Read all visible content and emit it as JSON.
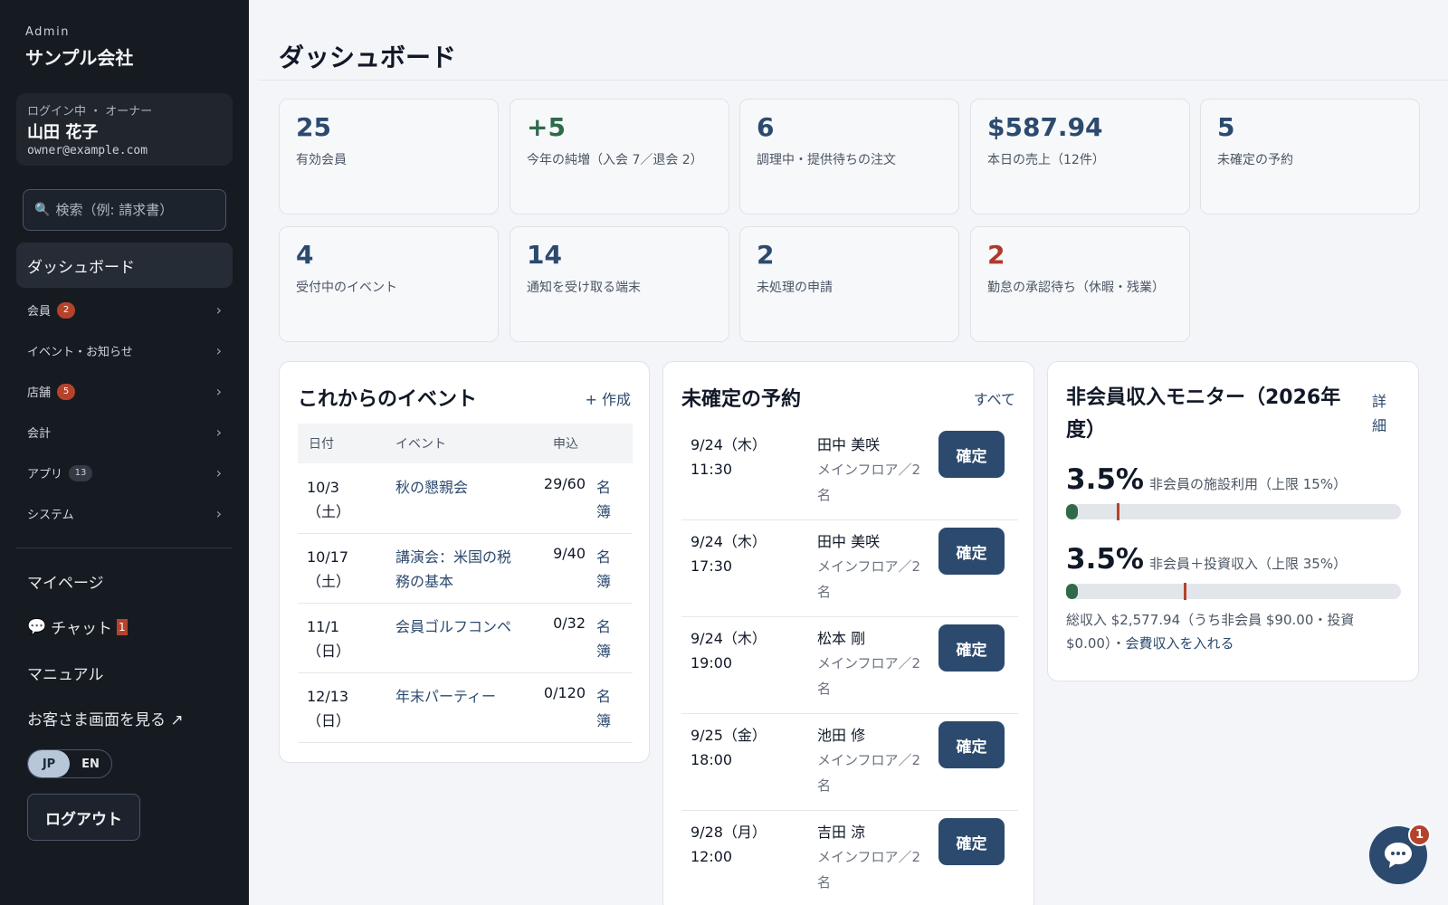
{
  "sidebar": {
    "brand_sub": "Admin",
    "brand_name": "サンプル会社",
    "user": {
      "role": "ログイン中 ・ オーナー",
      "name": "山田 花子",
      "email": "owner@example.com"
    },
    "search_placeholder": "検索（例: 請求書）",
    "active": "ダッシュボード",
    "items": [
      {
        "label": "会員",
        "badge": "2",
        "badge_type": "red"
      },
      {
        "label": "イベント・お知らせ",
        "badge": ""
      },
      {
        "label": "店舗",
        "badge": "5",
        "badge_type": "red"
      },
      {
        "label": "会計",
        "badge": ""
      },
      {
        "label": "アプリ",
        "badge": "13",
        "badge_type": "gray"
      },
      {
        "label": "システム",
        "badge": ""
      }
    ],
    "links": {
      "mypage": "マイページ",
      "chat": "チャット",
      "chat_badge": "1",
      "manual": "マニュアル",
      "customer": "お客さま画面を見る ↗"
    },
    "lang": {
      "jp": "JP",
      "en": "EN",
      "selected": "JP"
    },
    "logout": "ログアウト"
  },
  "page_title": "ダッシュボード",
  "stats": [
    {
      "value": "25",
      "label": "有効会員",
      "tone": ""
    },
    {
      "value": "+5",
      "label": "今年の純増（入会 7／退会 2）",
      "tone": "green"
    },
    {
      "value": "6",
      "label": "調理中・提供待ちの注文",
      "tone": ""
    },
    {
      "value": "$587.94",
      "label": "本日の売上（12件）",
      "tone": ""
    },
    {
      "value": "5",
      "label": "未確定の予約",
      "tone": ""
    },
    {
      "value": "4",
      "label": "受付中のイベント",
      "tone": ""
    },
    {
      "value": "14",
      "label": "通知を受け取る端末",
      "tone": ""
    },
    {
      "value": "2",
      "label": "未処理の申請",
      "tone": ""
    },
    {
      "value": "2",
      "label": "勤怠の承認待ち（休暇・残業）",
      "tone": "red"
    }
  ],
  "events": {
    "title": "これからのイベント",
    "action": "+ 作成",
    "headers": [
      "日付",
      "イベント",
      "申込"
    ],
    "rows": [
      {
        "date": "10/3（土）",
        "name": "秋の懇親会",
        "count": "29/60",
        "roster": "名簿"
      },
      {
        "date": "10/17（土）",
        "name": "講演会：米国の税務の基本",
        "count": "9/40",
        "roster": "名簿"
      },
      {
        "date": "11/1（日）",
        "name": "会員ゴルフコンペ",
        "count": "0/32",
        "roster": "名簿"
      },
      {
        "date": "12/13（日）",
        "name": "年末パーティー",
        "count": "0/120",
        "roster": "名簿"
      }
    ]
  },
  "reservations": {
    "title": "未確定の予約",
    "action": "すべて",
    "confirm_label": "確定",
    "rows": [
      {
        "date": "9/24（木）",
        "time": "11:30",
        "name": "田中 美咲",
        "place": "メインフロア／2名"
      },
      {
        "date": "9/24（木）",
        "time": "17:30",
        "name": "田中 美咲",
        "place": "メインフロア／2名"
      },
      {
        "date": "9/24（木）",
        "time": "19:00",
        "name": "松本 剛",
        "place": "メインフロア／2名"
      },
      {
        "date": "9/25（金）",
        "time": "18:00",
        "name": "池田 修",
        "place": "メインフロア／2名"
      },
      {
        "date": "9/28（月）",
        "time": "12:00",
        "name": "吉田 涼",
        "place": "メインフロア／2名"
      }
    ]
  },
  "monitor": {
    "title": "非会員収入モニター（2026年度）",
    "action": "詳細",
    "metrics": [
      {
        "pct": "3.5%",
        "label": "非会員の施設利用（上限 15%）",
        "value": 3.5,
        "limit": 15
      },
      {
        "pct": "3.5%",
        "label": "非会員＋投資収入（上限 35%）",
        "value": 3.5,
        "limit": 35
      }
    ],
    "summary": "総収入 $2,577.94（うち非会員 $90.00・投資 $0.00）・",
    "summary_link": "会費収入を入れる"
  },
  "fab_badge": "1"
}
